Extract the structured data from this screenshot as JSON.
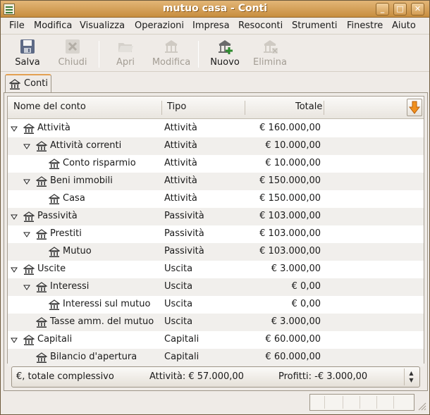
{
  "window": {
    "title": "mutuo casa - Conti",
    "btn_min": "_",
    "btn_max": "□",
    "btn_close": "✕"
  },
  "menu": [
    "File",
    "Modifica",
    "Visualizza",
    "Operazioni",
    "Impresa",
    "Resoconti",
    "Strumenti",
    "Finestre",
    "Aiuto"
  ],
  "toolbar": {
    "save": "Salva",
    "close": "Chiudi",
    "open": "Apri",
    "edit": "Modifica",
    "new": "Nuovo",
    "delete": "Elimina"
  },
  "tab": {
    "label": "Conti"
  },
  "columns": {
    "name": "Nome del conto",
    "type": "Tipo",
    "total": "Totale"
  },
  "rows": [
    {
      "name": "Attività",
      "type": "Attività",
      "total": "€ 160.000,00"
    },
    {
      "name": "Attività correnti",
      "type": "Attività",
      "total": "€ 10.000,00"
    },
    {
      "name": "Conto risparmio",
      "type": "Attività",
      "total": "€ 10.000,00"
    },
    {
      "name": "Beni immobili",
      "type": "Attività",
      "total": "€ 150.000,00"
    },
    {
      "name": "Casa",
      "type": "Attività",
      "total": "€ 150.000,00"
    },
    {
      "name": "Passività",
      "type": "Passività",
      "total": "€ 103.000,00"
    },
    {
      "name": "Prestiti",
      "type": "Passività",
      "total": "€ 103.000,00"
    },
    {
      "name": "Mutuo",
      "type": "Passività",
      "total": "€ 103.000,00"
    },
    {
      "name": "Uscite",
      "type": "Uscita",
      "total": "€ 3.000,00"
    },
    {
      "name": "Interessi",
      "type": "Uscita",
      "total": "€ 0,00"
    },
    {
      "name": "Interessi sul mutuo",
      "type": "Uscita",
      "total": "€ 0,00"
    },
    {
      "name": "Tasse amm. del mutuo",
      "type": "Uscita",
      "total": "€ 3.000,00"
    },
    {
      "name": "Capitali",
      "type": "Capitali",
      "total": "€ 60.000,00"
    },
    {
      "name": "Bilancio d'apertura",
      "type": "Capitali",
      "total": "€ 60.000,00"
    }
  ],
  "summary": {
    "currency": "€, totale complessivo",
    "assets": "Attività: € 57.000,00",
    "profits": "Profitti: -€ 3.000,00"
  },
  "colors": {
    "accent": "#c78d3e",
    "tab_highlight": "#e3a052",
    "new_icon_plus": "#2e8b2e",
    "sort_arrow": "#f0901e"
  }
}
